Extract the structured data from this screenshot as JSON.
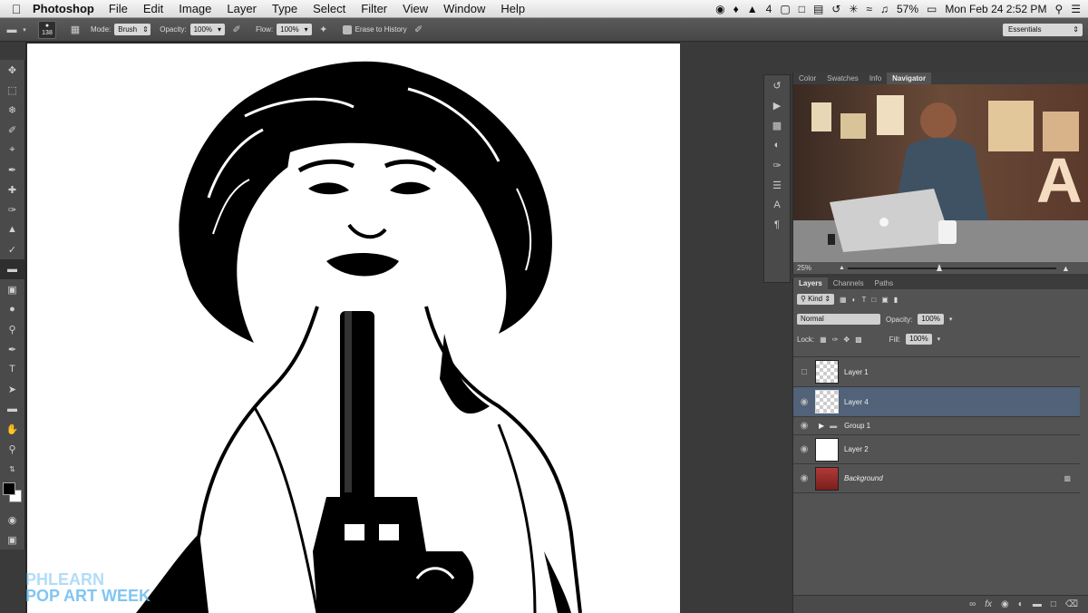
{
  "menubar": {
    "app": "Photoshop",
    "items": [
      "File",
      "Edit",
      "Image",
      "Layer",
      "Type",
      "Select",
      "Filter",
      "View",
      "Window",
      "Help"
    ],
    "battery": "57%",
    "clock": "Mon Feb 24  2:52 PM",
    "status_number": "4"
  },
  "options": {
    "brush_size": "138",
    "mode_label": "Mode:",
    "mode_value": "Brush",
    "opacity_label": "Opacity:",
    "opacity_value": "100%",
    "flow_label": "Flow:",
    "flow_value": "100%",
    "erase_label": "Erase to History",
    "workspace": "Essentials"
  },
  "nav_panel": {
    "tabs": [
      "Color",
      "Swatches",
      "Info",
      "Navigator"
    ],
    "active_tab": "Navigator",
    "zoom": "25%"
  },
  "layers_panel": {
    "tabs": [
      "Layers",
      "Channels",
      "Paths"
    ],
    "kind": "Kind",
    "blend_mode": "Normal",
    "opacity_label": "Opacity:",
    "opacity_value": "100%",
    "lock_label": "Lock:",
    "fill_label": "Fill:",
    "fill_value": "100%",
    "layers": [
      {
        "name": "Layer 1",
        "visible": false,
        "selected": false
      },
      {
        "name": "Layer 4",
        "visible": true,
        "selected": true
      },
      {
        "name": "Group 1",
        "visible": true,
        "selected": false
      },
      {
        "name": "Layer 2",
        "visible": true,
        "selected": false
      },
      {
        "name": "Background",
        "visible": true,
        "selected": false,
        "locked": true
      }
    ]
  },
  "watermark": {
    "line1": "PHLEARN",
    "line2": "POP ART WEEK"
  },
  "colors": {
    "selected_layer": "#516279",
    "watermark": "#62b7f0"
  }
}
